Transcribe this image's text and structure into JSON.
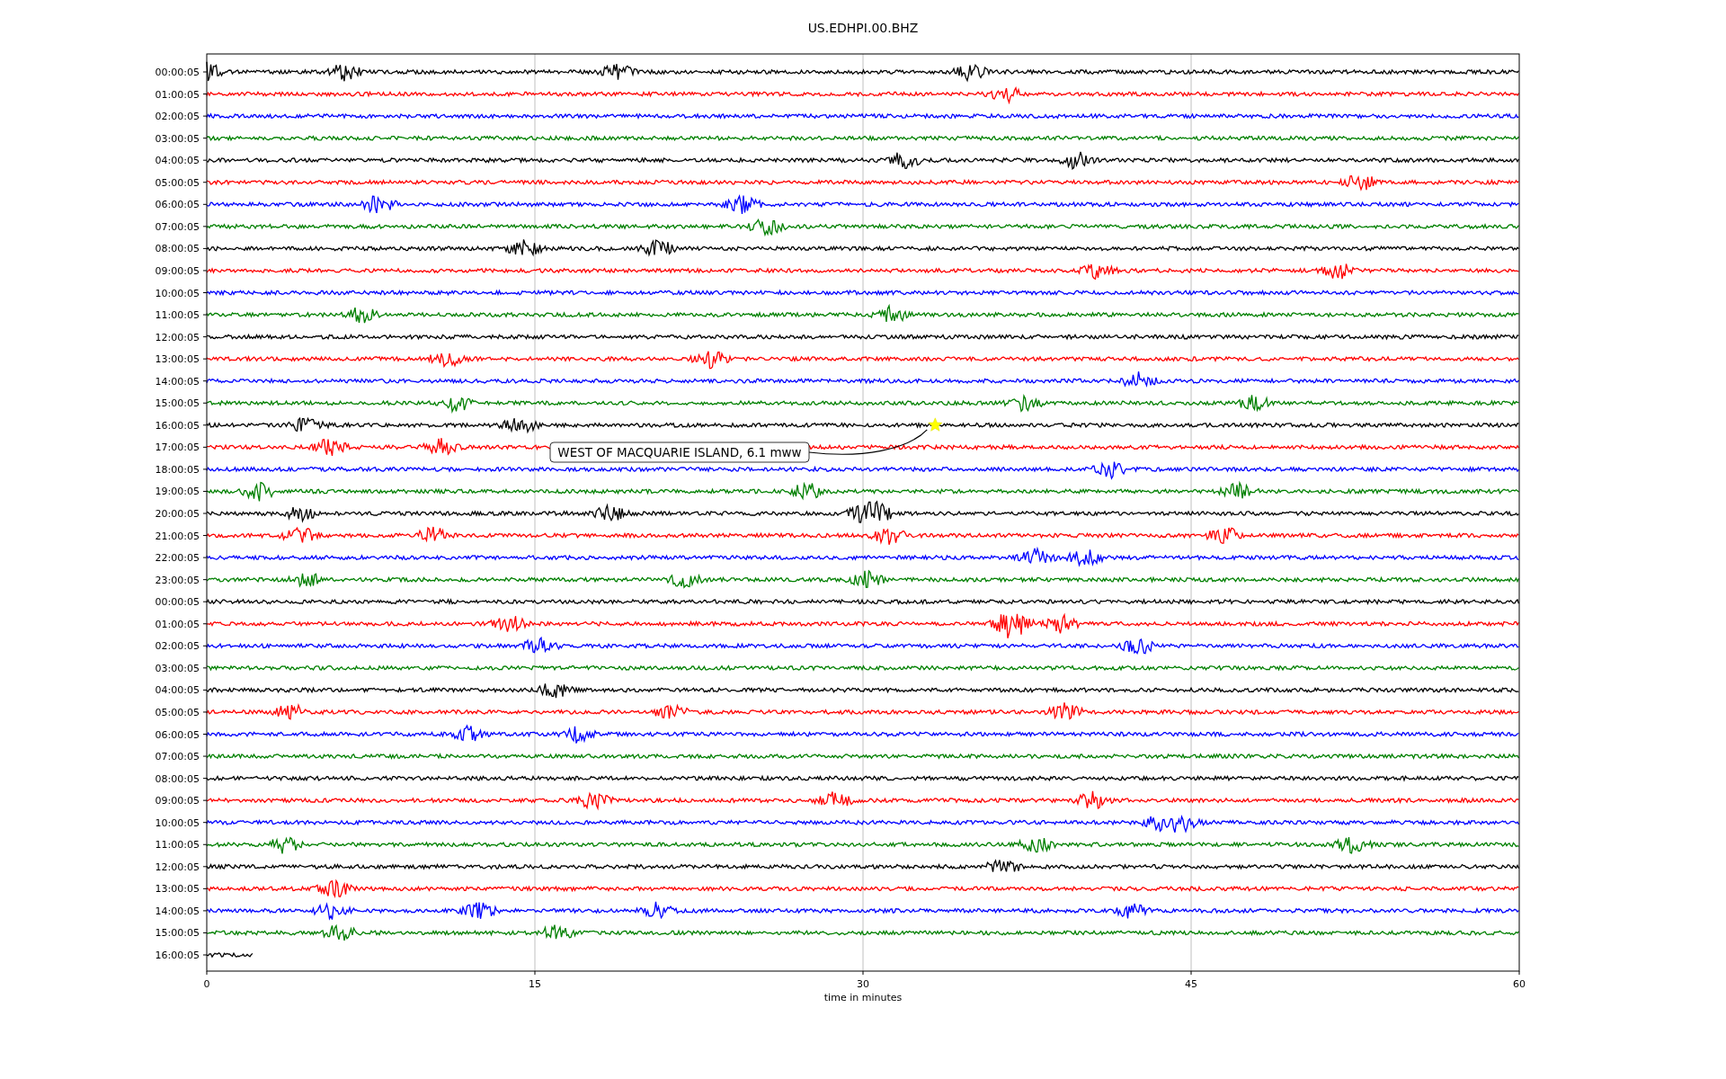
{
  "plot": {
    "title": "US.EDHPI.00.BHZ",
    "xlabel": "time in minutes",
    "xticks": [
      "0",
      "15",
      "30",
      "45",
      "60"
    ],
    "rows": [
      {
        "label": "00:00:05",
        "color": "#000000",
        "kind": "full"
      },
      {
        "label": "01:00:05",
        "color": "#ff0000",
        "kind": "full"
      },
      {
        "label": "02:00:05",
        "color": "#0000ff",
        "kind": "full"
      },
      {
        "label": "03:00:05",
        "color": "#008000",
        "kind": "full"
      },
      {
        "label": "04:00:05",
        "color": "#000000",
        "kind": "full"
      },
      {
        "label": "05:00:05",
        "color": "#ff0000",
        "kind": "full"
      },
      {
        "label": "06:00:05",
        "color": "#0000ff",
        "kind": "full"
      },
      {
        "label": "07:00:05",
        "color": "#008000",
        "kind": "full"
      },
      {
        "label": "08:00:05",
        "color": "#000000",
        "kind": "full"
      },
      {
        "label": "09:00:05",
        "color": "#ff0000",
        "kind": "full"
      },
      {
        "label": "10:00:05",
        "color": "#0000ff",
        "kind": "full"
      },
      {
        "label": "11:00:05",
        "color": "#008000",
        "kind": "full"
      },
      {
        "label": "12:00:05",
        "color": "#000000",
        "kind": "full"
      },
      {
        "label": "13:00:05",
        "color": "#ff0000",
        "kind": "full"
      },
      {
        "label": "14:00:05",
        "color": "#0000ff",
        "kind": "full"
      },
      {
        "label": "15:00:05",
        "color": "#008000",
        "kind": "full"
      },
      {
        "label": "16:00:05",
        "color": "#000000",
        "kind": "full"
      },
      {
        "label": "17:00:05",
        "color": "#ff0000",
        "kind": "full"
      },
      {
        "label": "18:00:05",
        "color": "#0000ff",
        "kind": "full"
      },
      {
        "label": "19:00:05",
        "color": "#008000",
        "kind": "full"
      },
      {
        "label": "20:00:05",
        "color": "#000000",
        "kind": "full"
      },
      {
        "label": "21:00:05",
        "color": "#ff0000",
        "kind": "full"
      },
      {
        "label": "22:00:05",
        "color": "#0000ff",
        "kind": "full"
      },
      {
        "label": "23:00:05",
        "color": "#008000",
        "kind": "full"
      },
      {
        "label": "00:00:05",
        "color": "#000000",
        "kind": "full"
      },
      {
        "label": "01:00:05",
        "color": "#ff0000",
        "kind": "full"
      },
      {
        "label": "02:00:05",
        "color": "#0000ff",
        "kind": "full"
      },
      {
        "label": "03:00:05",
        "color": "#008000",
        "kind": "full"
      },
      {
        "label": "04:00:05",
        "color": "#000000",
        "kind": "full"
      },
      {
        "label": "05:00:05",
        "color": "#ff0000",
        "kind": "full"
      },
      {
        "label": "06:00:05",
        "color": "#0000ff",
        "kind": "full"
      },
      {
        "label": "07:00:05",
        "color": "#008000",
        "kind": "full"
      },
      {
        "label": "08:00:05",
        "color": "#000000",
        "kind": "full"
      },
      {
        "label": "09:00:05",
        "color": "#ff0000",
        "kind": "full"
      },
      {
        "label": "10:00:05",
        "color": "#0000ff",
        "kind": "full"
      },
      {
        "label": "11:00:05",
        "color": "#008000",
        "kind": "full"
      },
      {
        "label": "12:00:05",
        "color": "#000000",
        "kind": "full"
      },
      {
        "label": "13:00:05",
        "color": "#ff0000",
        "kind": "full"
      },
      {
        "label": "14:00:05",
        "color": "#0000ff",
        "kind": "full"
      },
      {
        "label": "15:00:05",
        "color": "#008000",
        "kind": "full"
      },
      {
        "label": "16:00:05",
        "color": "#000000",
        "kind": "partial"
      }
    ],
    "event": {
      "label": "WEST OF MACQUARIE ISLAND, 6.1 mww"
    }
  }
}
